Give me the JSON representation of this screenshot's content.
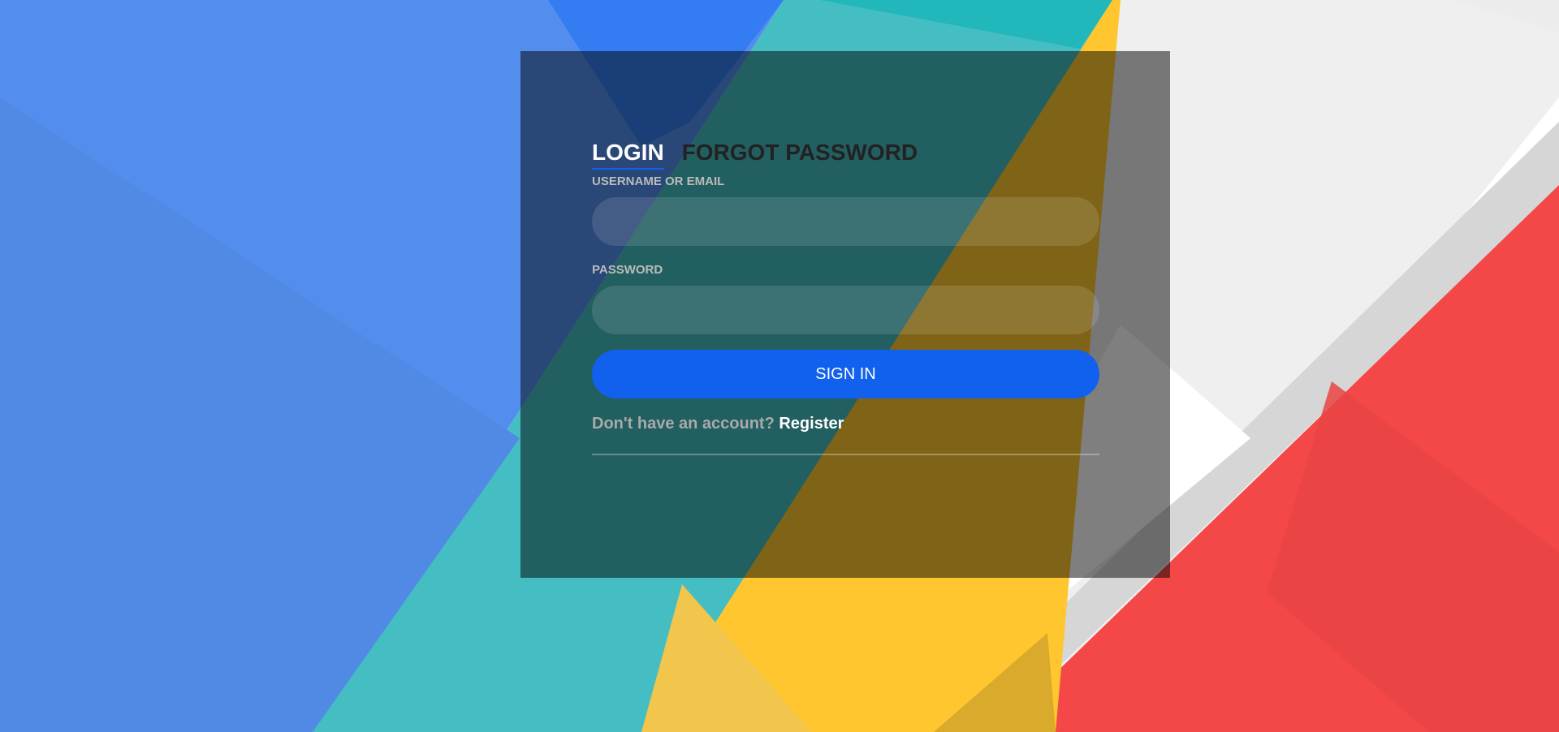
{
  "tabs": {
    "login": "LOGIN",
    "forgot": "FORGOT PASSWORD"
  },
  "fields": {
    "username_label": "USERNAME OR EMAIL",
    "username_value": "",
    "password_label": "PASSWORD",
    "password_value": ""
  },
  "buttons": {
    "sign_in": "SIGN IN"
  },
  "footer": {
    "prompt": "Don't have an account?",
    "register": "Register"
  },
  "colors": {
    "accent": "#1161ee",
    "bg_blue": "#538eef",
    "bg_teal": "#22b7bb",
    "bg_yellow": "#ffc62f",
    "bg_red": "#f44848"
  }
}
